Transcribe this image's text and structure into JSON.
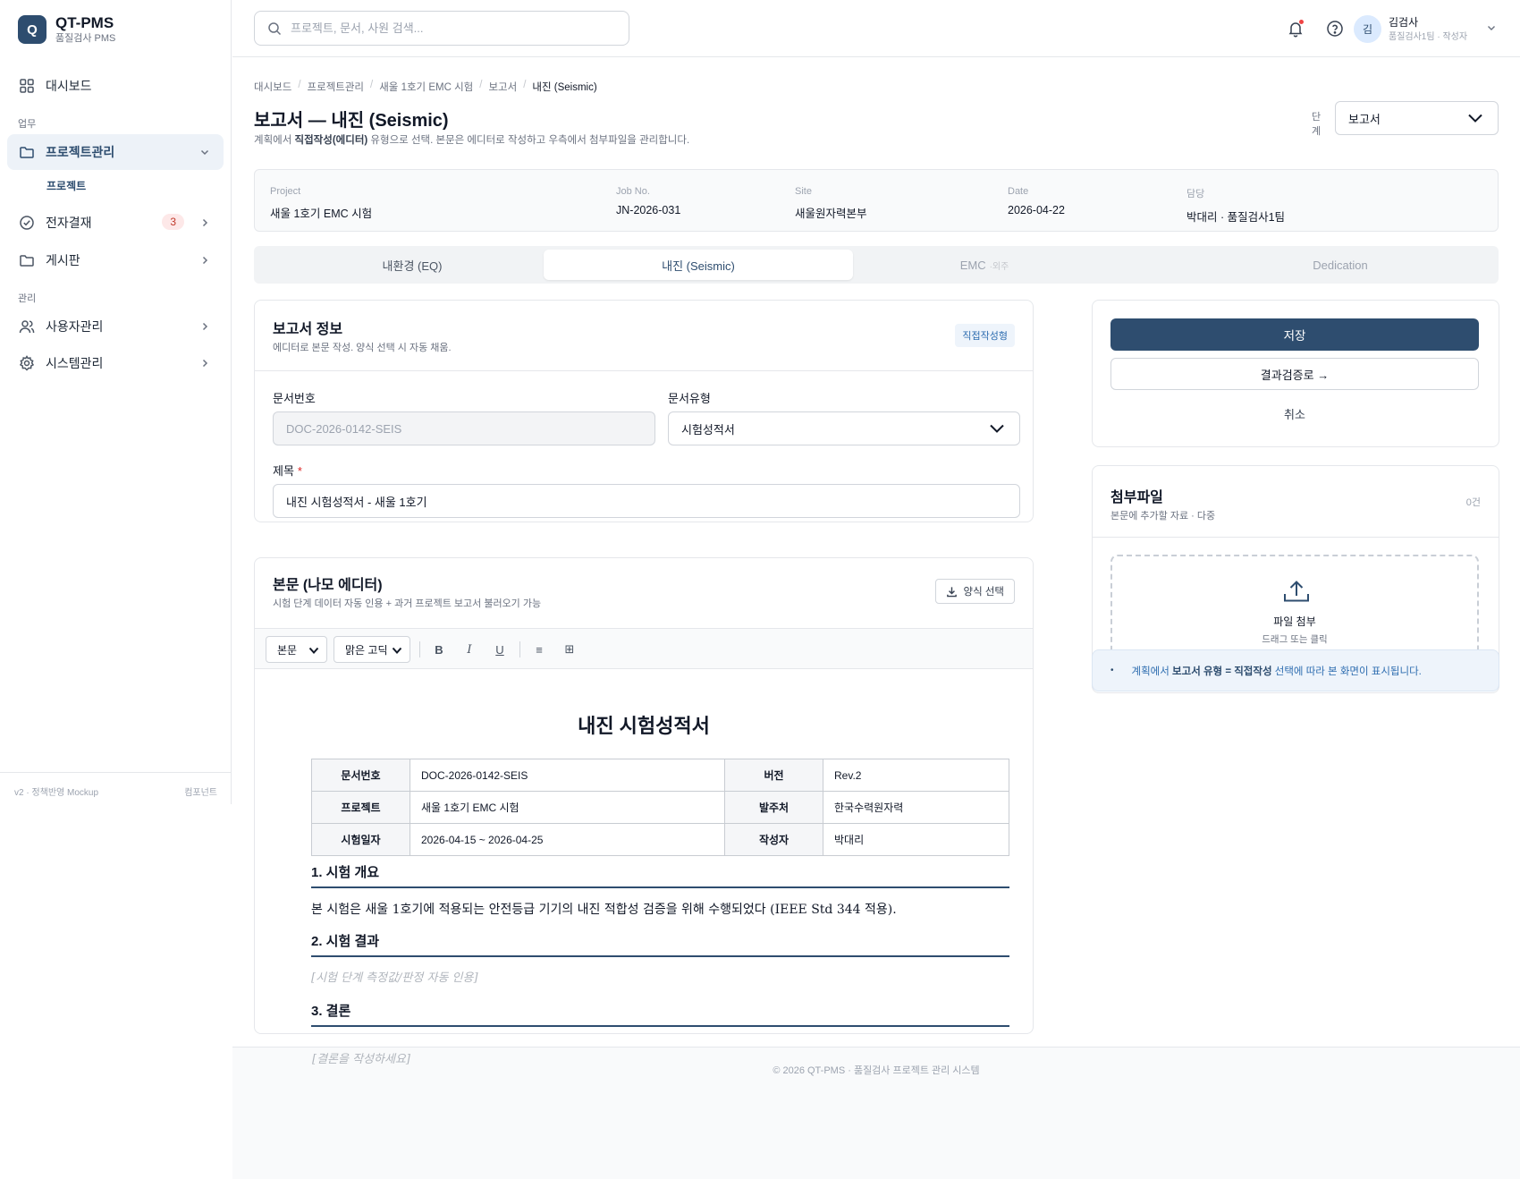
{
  "brand": {
    "name": "QT-PMS",
    "sub": "품질검사 PMS",
    "logo_letter": "Q"
  },
  "sidebar": {
    "items": [
      {
        "label": "대시보드",
        "icon": "grid-icon"
      },
      {
        "label": "프로젝트관리",
        "icon": "folder-icon"
      },
      {
        "label": "전자결재",
        "icon": "check-circle-icon",
        "badge": "3"
      },
      {
        "label": "게시판",
        "icon": "folder-icon"
      },
      {
        "label": "사용자관리",
        "icon": "users-icon"
      },
      {
        "label": "시스템관리",
        "icon": "gear-icon"
      }
    ],
    "section_work": "업무",
    "section_admin": "관리",
    "sub_item": "프로젝트",
    "footer_left": "v2 · 정책반영 Mockup",
    "footer_right": "컴포넌트"
  },
  "topbar": {
    "search_placeholder": "프로젝트, 문서, 사원 검색...",
    "user_initial": "김",
    "user_name": "김검사",
    "user_role": "품질검사1팀 · 작성자"
  },
  "breadcrumb": [
    "대시보드",
    "프로젝트관리",
    "새울 1호기 EMC 시험",
    "보고서",
    "내진 (Seismic)"
  ],
  "page": {
    "title": "보고서 — 내진 (Seismic)",
    "desc_pre": "계획에서 ",
    "desc_bold": "직접작성(에디터)",
    "desc_post": " 유형으로 선택. 본문은 에디터로 작성하고 우측에서 첨부파일을 관리합니다.",
    "stage_label": "단계",
    "stage_value": "보고서"
  },
  "meta": [
    {
      "label": "Project",
      "value": "새울 1호기 EMC 시험"
    },
    {
      "label": "Job No.",
      "value": "JN-2026-031"
    },
    {
      "label": "Site",
      "value": "새울원자력본부"
    },
    {
      "label": "Date",
      "value": "2026-04-22"
    },
    {
      "label": "담당",
      "value": "박대리 · 품질검사1팀"
    }
  ],
  "tabs": [
    {
      "label": "내환경 (EQ)",
      "note": ""
    },
    {
      "label": "내진 (Seismic)",
      "note": ""
    },
    {
      "label": "EMC",
      "note": "·외주"
    },
    {
      "label": "Dedication",
      "note": ""
    }
  ],
  "report_info": {
    "title": "보고서 정보",
    "sub": "에디터로 본문 작성. 양식 선택 시 자동 채움.",
    "chip": "직접작성형",
    "doc_no_label": "문서번호",
    "doc_no_value": "DOC-2026-0142-SEIS",
    "doc_type_label": "문서유형",
    "doc_type_value": "시험성적서",
    "subject_label": "제목",
    "subject_req": "*",
    "subject_value": "내진 시험성적서 - 새울 1호기"
  },
  "editor": {
    "title": "본문 (나모 에디터)",
    "sub": "시험 단계 데이터 자동 인용 + 과거 프로젝트 보고서 불러오기 가능",
    "template_button": "양식 선택",
    "style_select": "본문",
    "font_select": "맑은 고딕",
    "bold": "B",
    "italic": "I",
    "underline": "U",
    "list": "≡",
    "table": "⊞",
    "doc_title": "내진 시험성적서",
    "table_rows": [
      [
        "문서번호",
        "DOC-2026-0142-SEIS",
        "버전",
        "Rev.2"
      ],
      [
        "프로젝트",
        "새울 1호기 EMC 시험",
        "발주처",
        "한국수력원자력"
      ],
      [
        "시험일자",
        "2026-04-15 ~ 2026-04-25",
        "작성자",
        "박대리"
      ]
    ],
    "sec1": "1. 시험 개요",
    "sec1_text": "본 시험은 새울 1호기에 적용되는 안전등급 기기의 내진 적합성 검증을 위해 수행되었다 (IEEE Std 344 적용).",
    "sec2": "2. 시험 결과",
    "sec2_placeholder": "[시험 단계 측정값/판정 자동 인용]",
    "sec3": "3. 결론",
    "sec3_placeholder": "[결론을 작성하세요]"
  },
  "actions": {
    "save": "저장",
    "to_review": "결과검증로 →",
    "cancel": "취소"
  },
  "attachments": {
    "title": "첨부파일",
    "sub": "본문에 추가할 자료 · 다중",
    "count": "0건",
    "drop_title": "파일 첨부",
    "drop_sub": "드래그 또는 클릭"
  },
  "notice": {
    "pre": "계획에서 ",
    "bold": "보고서 유형 = 직접작성",
    "post": " 선택에 따라 본 화면이 표시됩니다."
  },
  "footer": "© 2026 QT-PMS · 품질검사 프로젝트 관리 시스템",
  "colors": {
    "primary": "#2e4d6f",
    "accent_blue": "#2e6db0",
    "danger": "#dc2626"
  }
}
